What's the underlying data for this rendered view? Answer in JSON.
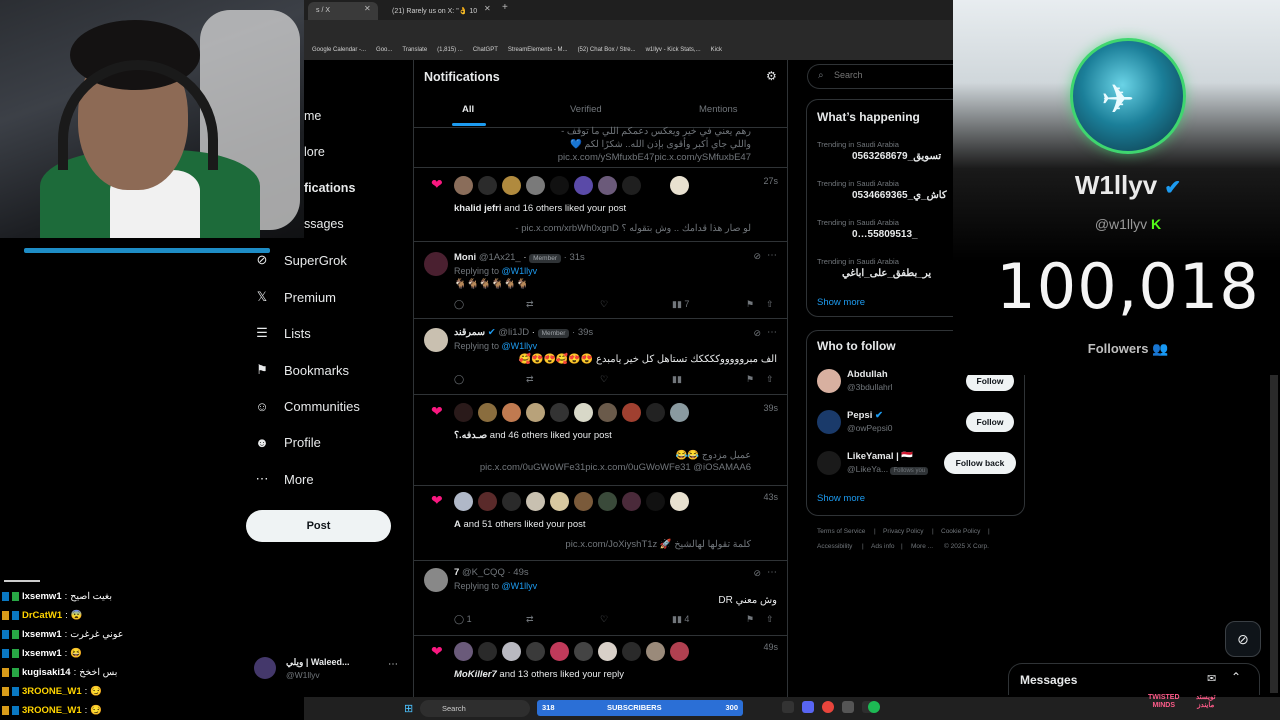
{
  "browser": {
    "tabs": [
      {
        "label": "s / X",
        "active": true
      },
      {
        "label": "(21) Rarely us on X: \"👌 10",
        "active": false
      }
    ],
    "bookmarks": [
      "Google Calendar -...",
      "Goo...",
      "Translate",
      "(1,815) ...",
      "ChatGPT",
      "StreamElements - M...",
      "(52) Chat Box / Stre...",
      "w1llyv - Kick Stats,...",
      "Kick"
    ]
  },
  "nav": {
    "cut_items": [
      "me",
      "lore",
      "fications",
      "ssages"
    ],
    "items": [
      {
        "label": "SuperGrok",
        "icon": "grok-icon",
        "glyph": "⊘"
      },
      {
        "label": "Premium",
        "icon": "x-logo-icon",
        "glyph": "𝕏"
      },
      {
        "label": "Lists",
        "icon": "list-icon",
        "glyph": "☰"
      },
      {
        "label": "Bookmarks",
        "icon": "bookmark-icon",
        "glyph": "⚑"
      },
      {
        "label": "Communities",
        "icon": "communities-icon",
        "glyph": "☺"
      },
      {
        "label": "Profile",
        "icon": "person-icon",
        "glyph": "☻"
      },
      {
        "label": "More",
        "icon": "more-circle-icon",
        "glyph": "⋯"
      }
    ],
    "post_label": "Post",
    "account": {
      "name": "ويلي | Waleed...",
      "handle": "@W1llyv",
      "more": "⋯"
    }
  },
  "chat": [
    {
      "name": "lxsemw1",
      "msg": "بغيت اصيح",
      "badge": "blue"
    },
    {
      "name": "DrCatW1",
      "msg": "😨",
      "badge": "gold"
    },
    {
      "name": "lxsemw1",
      "msg": "عوني غرغرت",
      "badge": "blue"
    },
    {
      "name": "lxsemw1",
      "msg": "😆",
      "badge": "blue"
    },
    {
      "name": "kugisaki14",
      "msg": "بس اخخخ",
      "badge": "gold"
    },
    {
      "name": "3ROONE_W1",
      "msg": "😏",
      "badge": "gold"
    },
    {
      "name": "3ROONE_W1",
      "msg": "😏",
      "badge": "gold"
    }
  ],
  "main": {
    "title": "Notifications",
    "tabs": [
      "All",
      "Verified",
      "Mentions"
    ],
    "top_snippet": {
      "line1": "رهم يعني في خير ويعكس دعمكم اللي ما توقف -",
      "line2": "واللي جاي أكبر وأقوى بإذن الله.. شكرًا لكم 💙",
      "line3": "pic.x.com/ySMfuxbE47pic.x.com/ySMfuxbE47"
    },
    "likes": [
      {
        "who": "khalid jefri",
        "rest": " and 16 others liked your post",
        "quote": "لو صار هذا قدامك .. وش بتقوله ؟ pic.x.com/xrbWh0xgnD -",
        "quote2": "",
        "time": "27s"
      },
      {
        "who": "صـدفه.؟",
        "rest": " and 46 others liked your post",
        "quote": "عميل مزدوج 😂😂",
        "quote2": "pic.x.com/0uGWoWFe31pic.x.com/0uGWoWFe31 @iOSAMAA6",
        "time": "39s"
      },
      {
        "who": "A",
        "rest": " and 51 others liked your post",
        "quote": "كلمة تقولها لهالشيخ 🚀 pic.x.com/JoXiyshT1z",
        "quote2": "",
        "time": "43s"
      },
      {
        "who": "MoKiller7",
        "rest": " and 13 others liked your reply",
        "quote": "",
        "quote2": "",
        "time": "49s"
      }
    ],
    "replies": [
      {
        "name": "Moni",
        "handle": "@1Ax21_",
        "member": "Member",
        "time": "31s",
        "replying": "Replying to",
        "to": "@W1llyv",
        "text": "🐐🐐🐐🐐🐐🐐",
        "views": "7",
        "replies_count": ""
      },
      {
        "name": "سمرقند",
        "handle": "@li1JD",
        "member": "Member",
        "time": "39s",
        "replying": "Replying to",
        "to": "@W1llyv",
        "text": "الف مبروووووككككك تستاهل كل خير يامبدع 😍😍🥰😍😍🥰",
        "views": "",
        "replies_count": ""
      },
      {
        "name": "7",
        "handle": "@K_CQQ",
        "member": "",
        "time": "49s",
        "replying": "Replying to",
        "to": "@W1llyv",
        "text": "وش معني DR",
        "views": "4",
        "replies_count": "1"
      }
    ]
  },
  "right": {
    "search_placeholder": "Search",
    "happening": {
      "title": "What’s happening",
      "trends": [
        {
          "ctx": "Trending in Saudi Arabia",
          "name": "0563268679_تسويق"
        },
        {
          "ctx": "Trending in Saudi Arabia",
          "name": "0534669365_كاش_ي"
        },
        {
          "ctx": "Trending in Saudi Arabia",
          "name": "0…55809513_"
        },
        {
          "ctx": "Trending in Saudi Arabia",
          "name": "ير_بطفق_على_اباغي"
        }
      ],
      "show_more": "Show more"
    },
    "who_to_follow": {
      "title": "Who to follow",
      "people": [
        {
          "name": "Abdullah",
          "handle": "@3bdullahrl",
          "button": "Follow",
          "badge": ""
        },
        {
          "name": "Pepsi",
          "handle": "@owPepsi0",
          "button": "Follow",
          "badge": ""
        },
        {
          "name": "LikeYamal | 🇾🇪",
          "handle": "@LikeYa...",
          "button": "Follow back",
          "badge": "Follows you"
        }
      ],
      "show_more": "Show more"
    },
    "footer": [
      "Terms of Service",
      "|",
      "Privacy Policy",
      "|",
      "Cookie Policy",
      "|",
      "Accessibility",
      "|",
      "Ads info",
      "|",
      "More ...",
      "© 2025 X Corp."
    ]
  },
  "overlay": {
    "name": "W1llyv",
    "handle": "@w1llyv",
    "count": "100,018",
    "label": "Followers",
    "messages_title": "Messages"
  },
  "taskbar": {
    "search": "Search",
    "subs_left": "318",
    "subs_mid": "SUBSCRIBERS",
    "subs_right": "300",
    "twisted": "TWISTED\nMINDS",
    "arabic_brand": "تويستد\nمايندز"
  },
  "colors": {
    "accent": "#1d9bf0",
    "like": "#f91880",
    "border": "#2f3336",
    "muted": "#71767b",
    "follower_ring": "#3fd66f"
  }
}
